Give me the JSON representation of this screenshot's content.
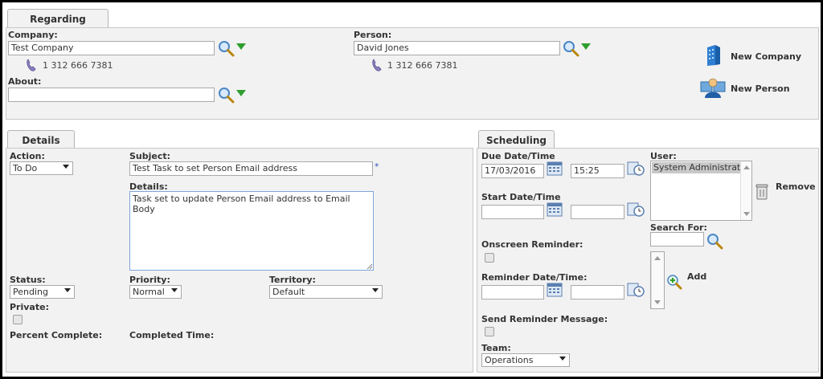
{
  "regarding": {
    "tab": "Regarding",
    "company_label": "Company:",
    "company_value": "Test Company",
    "company_phone": "1 312 666 7381",
    "about_label": "About:",
    "about_value": "",
    "person_label": "Person:",
    "person_value": "David Jones",
    "person_phone": "1 312 666 7381",
    "new_company": "New Company",
    "new_person": "New Person"
  },
  "details": {
    "tab": "Details",
    "action_label": "Action:",
    "action_value": "To Do",
    "subject_label": "Subject:",
    "subject_value": "Test Task to set Person Email address",
    "required_mark": "*",
    "details_label": "Details:",
    "details_value": "Task set to update Person Email address to Email Body",
    "status_label": "Status:",
    "status_value": "Pending",
    "priority_label": "Priority:",
    "priority_value": "Normal",
    "territory_label": "Territory:",
    "territory_value": "Default",
    "private_label": "Private:",
    "percent_label": "Percent Complete:",
    "completed_label": "Completed Time:"
  },
  "scheduling": {
    "tab": "Scheduling",
    "due_label": "Due Date/Time",
    "due_date": "17/03/2016",
    "due_time": "15:25",
    "start_label": "Start Date/Time",
    "start_date": "",
    "start_time": "",
    "onscreen_label": "Onscreen Reminder:",
    "reminder_label": "Reminder Date/Time:",
    "reminder_date": "",
    "reminder_time": "",
    "send_reminder_label": "Send Reminder Message:",
    "team_label": "Team:",
    "team_value": "Operations",
    "user_label": "User:",
    "user_items": [
      "System Administrator"
    ],
    "remove_label": "Remove",
    "search_label": "Search For:",
    "search_value": "",
    "add_label": "Add"
  },
  "colors": {
    "panel_bg": "#f2f2f2",
    "border": "#c8c8c8",
    "search_lens": "#4a86c5",
    "dropdown_arrow": "#2e9e2e",
    "required": "#3355bb"
  }
}
